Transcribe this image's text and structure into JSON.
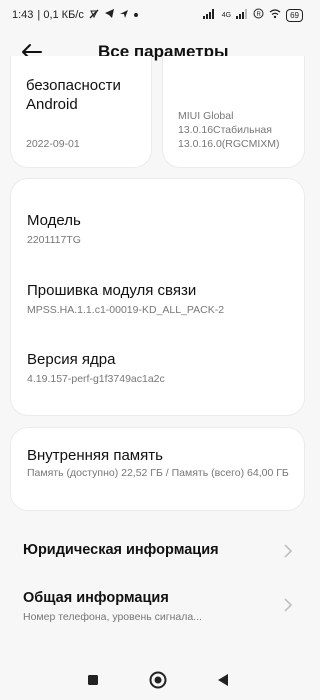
{
  "status_bar": {
    "time": "1:43",
    "speed": "| 0,1 КБ/с",
    "network": "4G",
    "battery": "69"
  },
  "header": {
    "title": "Все параметры"
  },
  "cards": {
    "android_security": {
      "title": "безопасности Android",
      "date": "2022-09-01"
    },
    "miui": {
      "line1": "MIUI Global",
      "line2": "13.0.16Стабильная",
      "line3": "13.0.16.0(RGCMIXM)"
    },
    "model": {
      "label": "Модель",
      "value": "2201117TG"
    },
    "baseband": {
      "label": "Прошивка модуля связи",
      "value": "MPSS.HA.1.1.c1-00019-KD_ALL_PACK-2"
    },
    "kernel": {
      "label": "Версия ядра",
      "value": "4.19.157-perf-g1f3749ac1a2c"
    },
    "storage": {
      "label": "Внутренняя память",
      "value": "Память (доступно) 22,52 ГБ / Память (всего) 64,00 ГБ"
    }
  },
  "list": {
    "legal": {
      "title": "Юридическая информация"
    },
    "general": {
      "title": "Общая информация",
      "subtitle": "Номер телефона, уровень сигнала..."
    }
  },
  "icons": {
    "back": "arrow-left-icon",
    "chevron": "chevron-right-icon",
    "recents": "square-icon",
    "home": "circle-icon",
    "back_nav": "triangle-icon"
  }
}
